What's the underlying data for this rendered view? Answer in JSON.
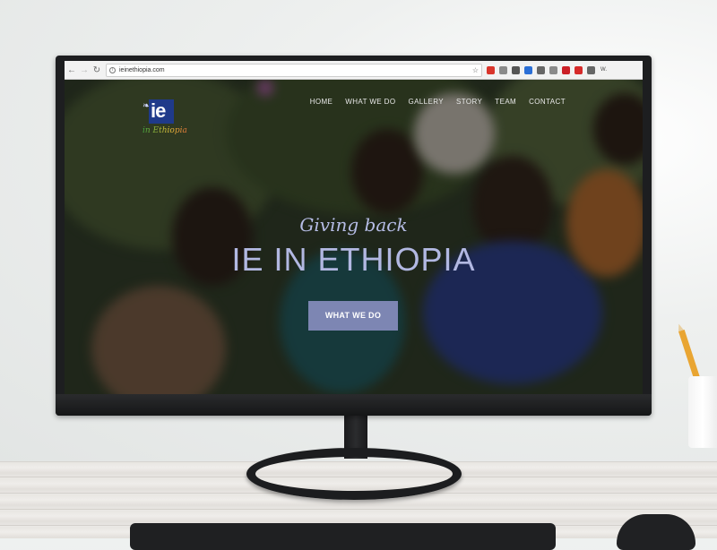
{
  "browser": {
    "url": "ieinethiopia.com",
    "extension_overflow_label": "W.",
    "extensions": [
      {
        "icon": "red-badge-icon",
        "color": "#d9342b"
      },
      {
        "icon": "square-icon",
        "color": "#8a8a8a"
      },
      {
        "icon": "circle-icon",
        "color": "#555555"
      },
      {
        "icon": "vee-icon",
        "color": "#2b6fd6"
      },
      {
        "icon": "pages-icon",
        "color": "#666666"
      },
      {
        "icon": "cloud-icon",
        "color": "#8a8a8a"
      },
      {
        "icon": "pinterest-icon",
        "color": "#cb2027"
      },
      {
        "icon": "play-icon",
        "color": "#d62a2a"
      },
      {
        "icon": "cast-icon",
        "color": "#666666"
      }
    ]
  },
  "site": {
    "logo": {
      "mark": "ie",
      "sub": "in Ethiopia"
    },
    "nav": [
      "HOME",
      "WHAT WE DO",
      "GALLERY",
      "STORY",
      "TEAM",
      "CONTACT"
    ],
    "hero": {
      "tagline": "Giving back",
      "headline": "IE IN ETHIOPIA",
      "cta": "WHAT WE DO"
    },
    "colors": {
      "accent": "#7d86b3",
      "headline": "#b2b8e2",
      "logo_bg": "#1f3a8a"
    }
  }
}
